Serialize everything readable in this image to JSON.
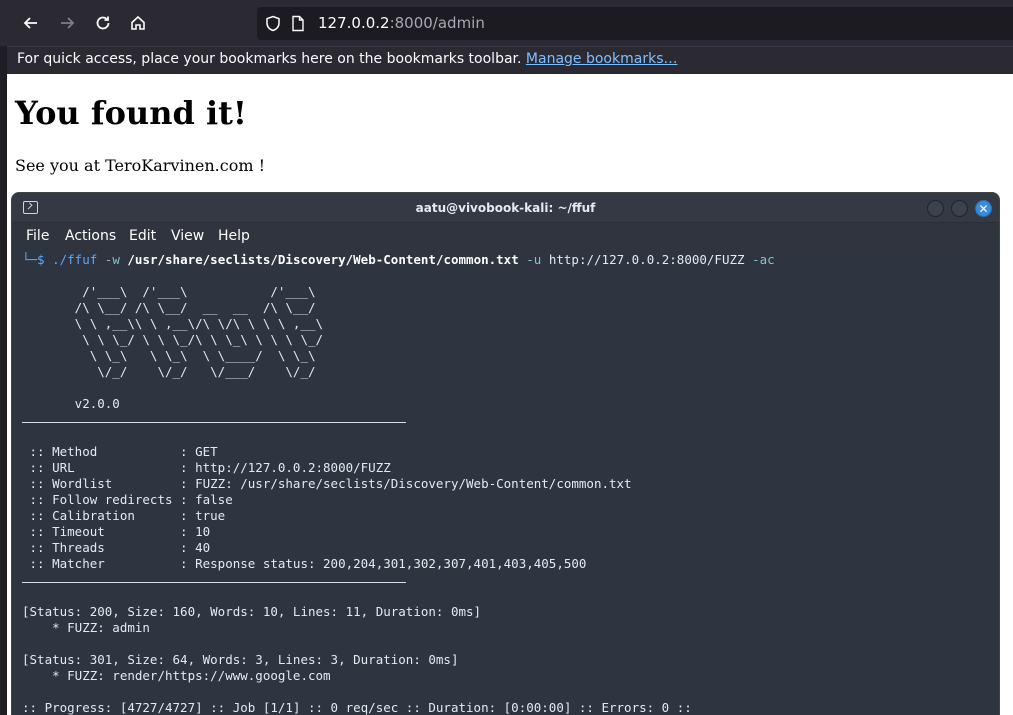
{
  "browser": {
    "url_host": "127.0.0.2",
    "url_rest": ":8000/admin",
    "bookmarks_message": "For quick access, place your bookmarks here on the bookmarks toolbar.",
    "bookmarks_link": "Manage bookmarks…"
  },
  "page": {
    "heading": "You found it!",
    "text": "See you at TeroKarvinen.com !"
  },
  "terminal": {
    "title": "aatu@vivobook-kali: ~/ffuf",
    "menu": [
      "File",
      "Actions",
      "Edit",
      "View",
      "Help"
    ],
    "prompt": "└─$",
    "cmd_exe": "./ffuf",
    "cmd_w": "-w",
    "cmd_wordlist": "/usr/share/seclists/Discovery/Web-Content/common.txt",
    "cmd_u": "-u",
    "cmd_url": "http://127.0.0.2:8000/FUZZ",
    "cmd_ac": "-ac",
    "banner": [
      "        /'___\\  /'___\\           /'___\\",
      "       /\\ \\__/ /\\ \\__/  __  __  /\\ \\__/",
      "       \\ \\ ,__\\\\ \\ ,__\\/\\ \\/\\ \\ \\ \\ ,__\\",
      "        \\ \\ \\_/ \\ \\ \\_/\\ \\ \\_\\ \\ \\ \\ \\_/",
      "         \\ \\_\\   \\ \\_\\  \\ \\____/  \\ \\_\\",
      "          \\/_/    \\/_/   \\/___/    \\/_/"
    ],
    "version": "       v2.0.0",
    "config": [
      " :: Method           : GET",
      " :: URL              : http://127.0.0.2:8000/FUZZ",
      " :: Wordlist         : FUZZ: /usr/share/seclists/Discovery/Web-Content/common.txt",
      " :: Follow redirects : false",
      " :: Calibration      : true",
      " :: Timeout          : 10",
      " :: Threads          : 40",
      " :: Matcher          : Response status: 200,204,301,302,307,401,403,405,500"
    ],
    "results": [
      {
        "status": "[Status: 200, Size: 160, Words: 10, Lines: 11, Duration: 0ms]",
        "fuzz": "    * FUZZ: admin"
      },
      {
        "status": "[Status: 301, Size: 64, Words: 3, Lines: 3, Duration: 0ms]",
        "fuzz": "    * FUZZ: render/https://www.google.com"
      }
    ],
    "progress": ":: Progress: [4727/4727] :: Job [1/1] :: 0 req/sec :: Duration: [0:00:00] :: Errors: 0 ::"
  }
}
